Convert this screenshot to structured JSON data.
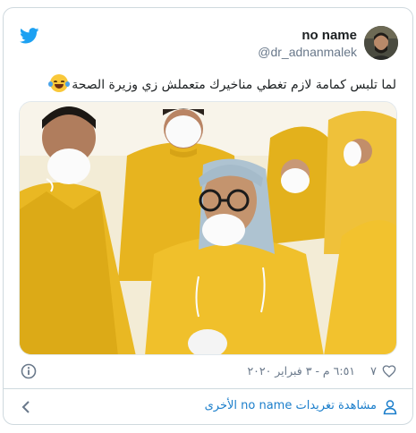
{
  "tweet": {
    "author_name": "no name",
    "author_handle": "@dr_adnanmalek",
    "text": "لما تلبس كمامة لازم تغطي مناخيرك متعملش زي وزيرة الصحة",
    "emoji": "face-with-tears-of-joy",
    "timestamp": "٦:٥١ م - ٣ فبراير ٢٠٢٠",
    "like_count": "٧",
    "more_tweets_label": "مشاهدة تغريدات no name الأخرى"
  },
  "icons": {
    "brand": "twitter-bird-icon",
    "info": "info-icon",
    "like": "heart-icon",
    "profile": "person-icon",
    "navigate": "chevron-left-icon"
  },
  "colors": {
    "twitter_blue": "#1da1f2",
    "link_blue": "#1b7ecb",
    "muted_text": "#69788a",
    "border": "#cfd9de",
    "suit_yellow": "#e8b51e"
  }
}
